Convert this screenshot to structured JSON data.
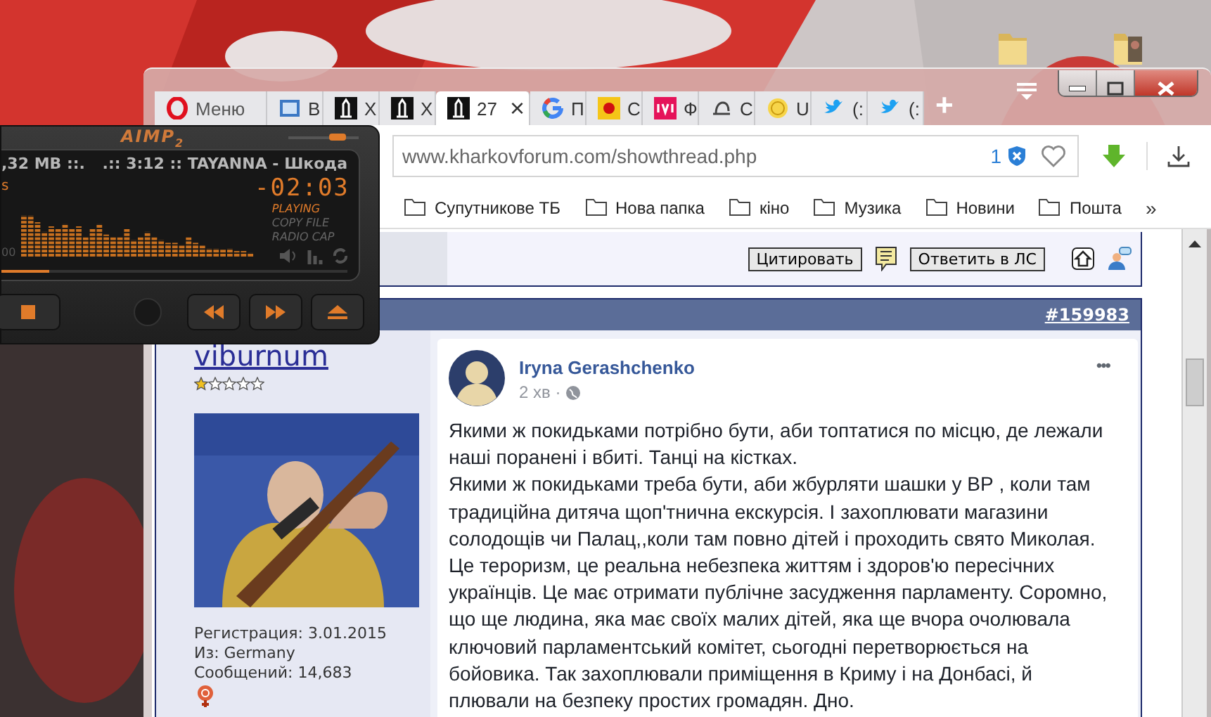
{
  "browser": {
    "menu_label": "Меню",
    "tabs": [
      {
        "label": "В",
        "selected": false
      },
      {
        "label": "Х",
        "selected": false
      },
      {
        "label": "Х",
        "selected": false
      },
      {
        "label": "27",
        "selected": true,
        "close": "×"
      },
      {
        "label": "П",
        "selected": false
      },
      {
        "label": "С",
        "selected": false
      },
      {
        "label": "Ф",
        "selected": false
      },
      {
        "label": "С",
        "selected": false
      },
      {
        "label": "U",
        "selected": false
      },
      {
        "label": "(:",
        "selected": false
      },
      {
        "label": "(:",
        "selected": false
      }
    ],
    "new_tab": "+",
    "url": "www.kharkovforum.com/showthread.php",
    "tracker_count": "1",
    "bookmarks": [
      "Супутникове ТБ",
      "Нова папка",
      "кіно",
      "Музика",
      "Новини",
      "Пошта"
    ],
    "bookmarks_more": "»"
  },
  "forum": {
    "buttons": [
      "Цитировать",
      "Ответить в ЛС"
    ],
    "post": {
      "number": "#159983",
      "user": {
        "name": "viburnum",
        "stars": 1,
        "details": [
          "Регистрация: 3.01.2015",
          "Из: Germany",
          "Сообщений: 14,683"
        ]
      },
      "embed": {
        "author": "Iryna Gerashchenko",
        "time": "2 хв ·",
        "more": "•••",
        "paragraphs": [
          "Якими ж покидьками потрібно бути, аби топтатися по місцю, де лежали наші поранені і вбиті. Танці на кістках.",
          "Якими ж покидьками треба бути, аби жбурляти шашки у ВР , коли там традиційна дитяча щоп'тнична екскурсія. І захоплювати магазини солодощів чи Палац,,коли там повно дітей і проходить свято Миколая. Це тероризм, це реальна небезпека життям і здоров'ю пересічних українців. Це має отримати публічне засудження парламенту. Соромно, що ще людина, яка має своїх малих дітей, яка ще вчора очолювала ключовий парламентський комітет, сьогодні перетворюється на бойовика. Так захоплювали приміщення в Криму і на Донбасі, й плювали на безпеку простих громадян. Дно."
        ]
      }
    }
  },
  "aimp": {
    "logo": "AIMP$_{2}$",
    "volume": {
      "level": 0.7
    },
    "size_info": ",32 MB ::.",
    "track": ".:: 3:12 :: TAYANNA - Шкода",
    "unit": "s",
    "time": "-02:03",
    "status": [
      {
        "label": "PLAYING",
        "on": true
      },
      {
        "label": "COPY FILE",
        "on": false
      },
      {
        "label": "RADIO CAP",
        "on": false
      }
    ],
    "counter": "00",
    "seek": {
      "level": 0.14
    }
  }
}
